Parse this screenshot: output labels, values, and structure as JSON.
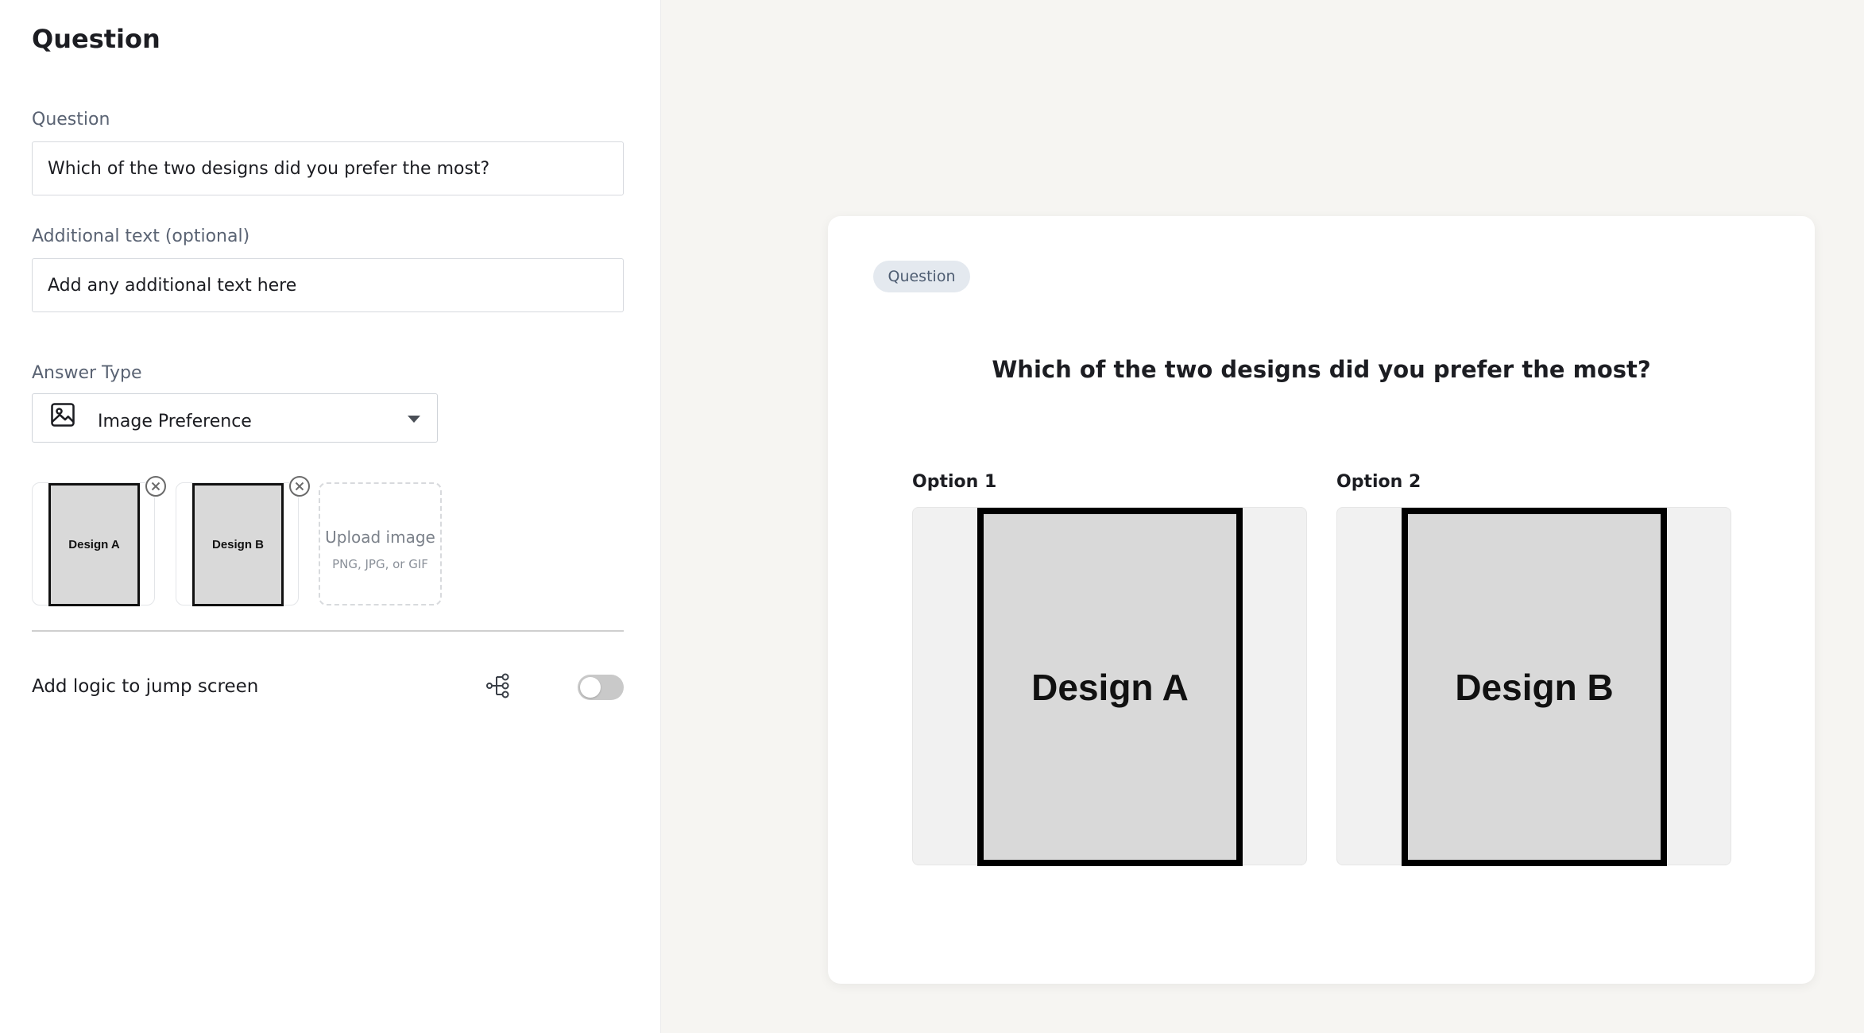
{
  "editor": {
    "title": "Question",
    "question_label": "Question",
    "question_value": "Which of the two designs did you prefer the most?",
    "additional_label": "Additional text (optional)",
    "additional_placeholder": "Add any additional text here",
    "answer_type_label": "Answer Type",
    "answer_type_value": "Image Preference",
    "images": [
      {
        "label": "Design A"
      },
      {
        "label": "Design B"
      }
    ],
    "upload": {
      "title": "Upload image",
      "formats": "PNG, JPG, or GIF"
    },
    "logic_label": "Add logic to jump screen",
    "logic_enabled": false
  },
  "preview": {
    "badge": "Question",
    "question": "Which of the two designs did you prefer the most?",
    "options": [
      {
        "label": "Option 1",
        "image_text": "Design A"
      },
      {
        "label": "Option 2",
        "image_text": "Design B"
      }
    ]
  },
  "colors": {
    "page_bg": "#f6f5f2",
    "badge_bg": "#e4e9ef",
    "badge_text": "#4e5d72",
    "toggle_off": "#c9c9c9"
  }
}
